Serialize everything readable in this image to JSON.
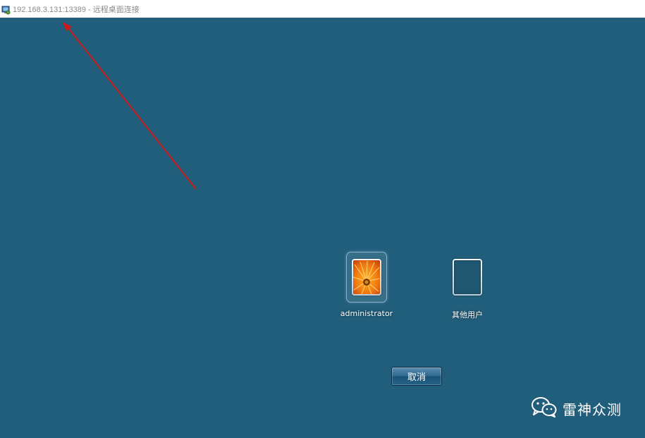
{
  "window": {
    "title": "192.168.3.131:13389 - 远程桌面连接",
    "title_icon": "remote-desktop-icon"
  },
  "desktop": {
    "background_color": "#215e7b"
  },
  "annotation": {
    "type": "arrow",
    "color": "#d11a1a",
    "points_to": "window-title"
  },
  "accounts": [
    {
      "name": "administrator",
      "picture": "flower-picture",
      "selected": true
    },
    {
      "name": "其他用户",
      "picture": "empty",
      "selected": false
    }
  ],
  "buttons": {
    "cancel_label": "取消"
  },
  "watermark": {
    "icon": "wechat-icon",
    "text": "雷神众测"
  }
}
